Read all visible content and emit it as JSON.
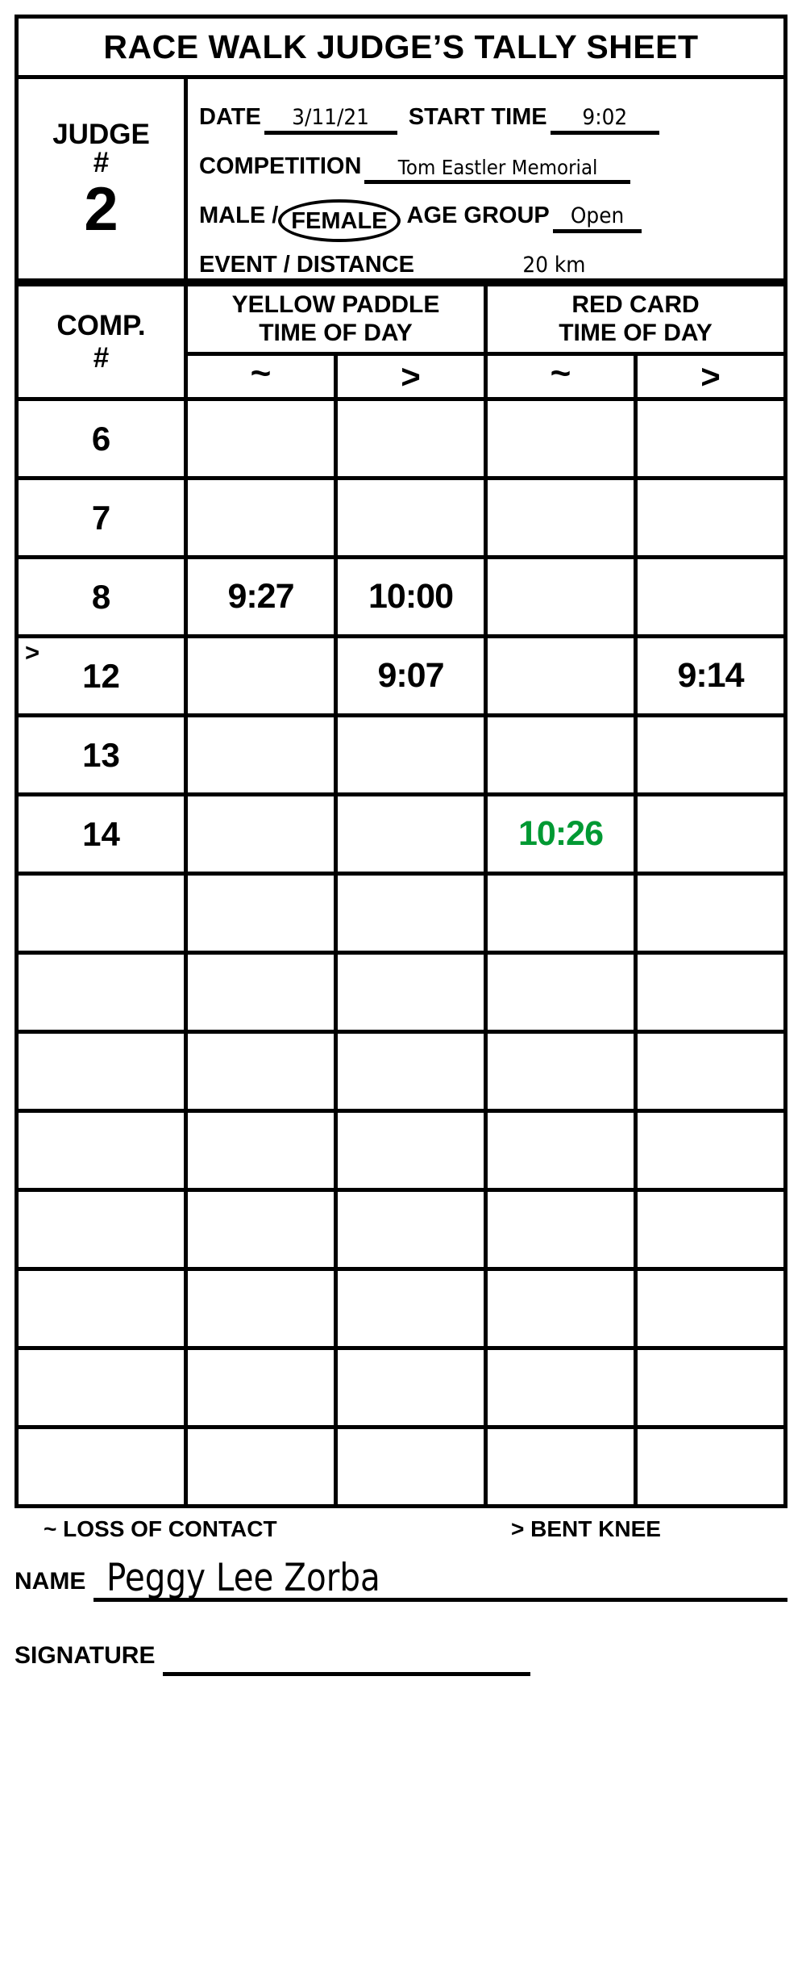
{
  "title": "RACE WALK JUDGE’S TALLY SHEET",
  "judge": {
    "label_line1": "JUDGE",
    "label_line2": "#",
    "number": "2"
  },
  "fields": {
    "date_label": "DATE",
    "date_value": "3/11/21",
    "start_time_label": "START TIME",
    "start_time_value": "9:02",
    "competition_label": "COMPETITION",
    "competition_value": "Tom Eastler Memorial",
    "male_label": "MALE /",
    "female_label": "FEMALE",
    "age_group_label": "AGE GROUP",
    "age_group_value": "Open",
    "event_label": "EVENT / DISTANCE",
    "event_value": "20 km",
    "gender_selected": "FEMALE"
  },
  "table": {
    "comp_header_line1": "COMP.",
    "comp_header_line2": "#",
    "yellow_header_line1": "YELLOW PADDLE",
    "yellow_header_line2": "TIME OF DAY",
    "red_header_line1": "RED CARD",
    "red_header_line2": "TIME OF DAY",
    "symbols": [
      "~",
      ">",
      "~",
      ">"
    ],
    "rows": [
      {
        "num": "6",
        "mark": "",
        "y_tilde": "",
        "y_gt": "",
        "r_tilde": "",
        "r_gt": ""
      },
      {
        "num": "7",
        "mark": "",
        "y_tilde": "",
        "y_gt": "",
        "r_tilde": "",
        "r_gt": ""
      },
      {
        "num": "8",
        "mark": "",
        "y_tilde": "9:27",
        "y_gt": "10:00",
        "r_tilde": "",
        "r_gt": ""
      },
      {
        "num": "12",
        "mark": ">",
        "y_tilde": "",
        "y_gt": "9:07",
        "r_tilde": "",
        "r_gt": "9:14"
      },
      {
        "num": "13",
        "mark": "",
        "y_tilde": "",
        "y_gt": "",
        "r_tilde": "",
        "r_gt": ""
      },
      {
        "num": "14",
        "mark": "",
        "y_tilde": "",
        "y_gt": "",
        "r_tilde": "10:26",
        "r_gt": "",
        "r_tilde_green": true
      },
      {
        "num": "",
        "mark": "",
        "y_tilde": "",
        "y_gt": "",
        "r_tilde": "",
        "r_gt": ""
      },
      {
        "num": "",
        "mark": "",
        "y_tilde": "",
        "y_gt": "",
        "r_tilde": "",
        "r_gt": ""
      },
      {
        "num": "",
        "mark": "",
        "y_tilde": "",
        "y_gt": "",
        "r_tilde": "",
        "r_gt": ""
      },
      {
        "num": "",
        "mark": "",
        "y_tilde": "",
        "y_gt": "",
        "r_tilde": "",
        "r_gt": ""
      },
      {
        "num": "",
        "mark": "",
        "y_tilde": "",
        "y_gt": "",
        "r_tilde": "",
        "r_gt": ""
      },
      {
        "num": "",
        "mark": "",
        "y_tilde": "",
        "y_gt": "",
        "r_tilde": "",
        "r_gt": ""
      },
      {
        "num": "",
        "mark": "",
        "y_tilde": "",
        "y_gt": "",
        "r_tilde": "",
        "r_gt": ""
      },
      {
        "num": "",
        "mark": "",
        "y_tilde": "",
        "y_gt": "",
        "r_tilde": "",
        "r_gt": ""
      }
    ]
  },
  "footer": {
    "legend_contact": "~ LOSS OF CONTACT",
    "legend_knee": "> BENT KNEE",
    "name_label": "NAME",
    "name_value": "Peggy Lee Zorba",
    "signature_label": "SIGNATURE",
    "signature_value": ""
  },
  "colors": {
    "ink": "#000000",
    "green_entry": "#009933",
    "paper": "#ffffff"
  }
}
